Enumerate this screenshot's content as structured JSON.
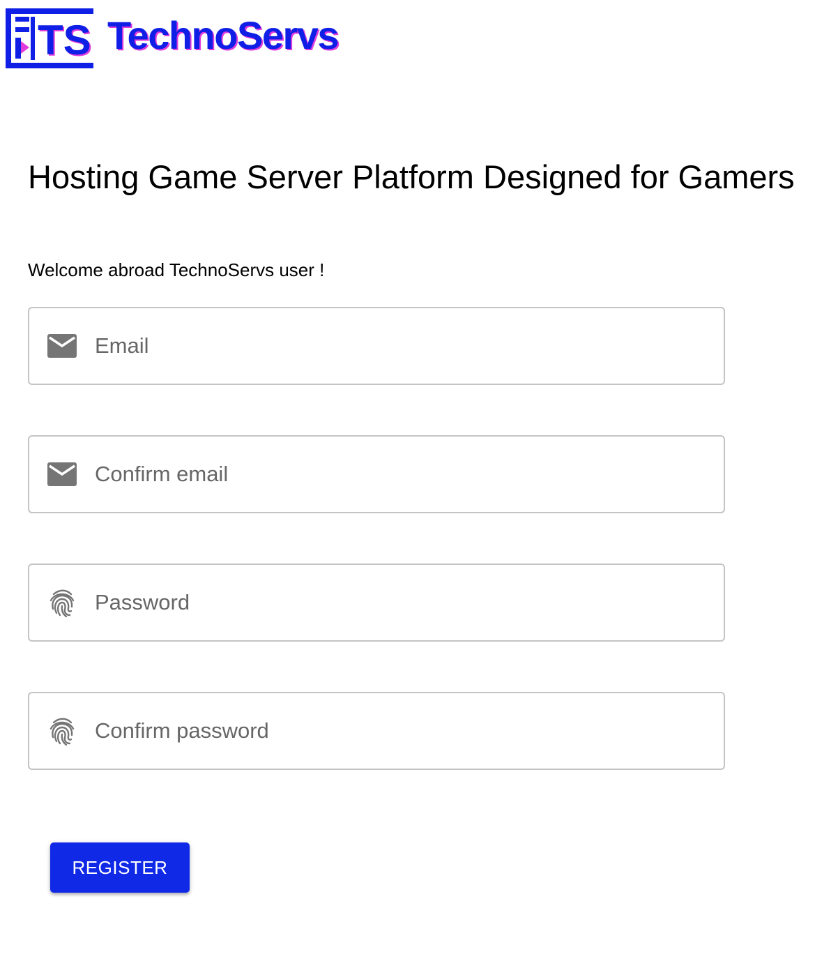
{
  "brand": {
    "name": "TechnoServs",
    "monogram": "TS",
    "primary_color": "#0f1fe6",
    "accent_color": "#e23bdc"
  },
  "headline": "Hosting Game Server Platform Designed for Gamers",
  "welcome_text": "Welcome abroad TechnoServs user !",
  "form": {
    "email": {
      "placeholder": "Email",
      "value": "",
      "icon": "mail-icon"
    },
    "confirm_email": {
      "placeholder": "Confirm email",
      "value": "",
      "icon": "mail-icon"
    },
    "password": {
      "placeholder": "Password",
      "value": "",
      "icon": "fingerprint-icon"
    },
    "confirm_password": {
      "placeholder": "Confirm password",
      "value": "",
      "icon": "fingerprint-icon"
    },
    "register_label": "REGISTER",
    "button_color": "#1029e6"
  }
}
